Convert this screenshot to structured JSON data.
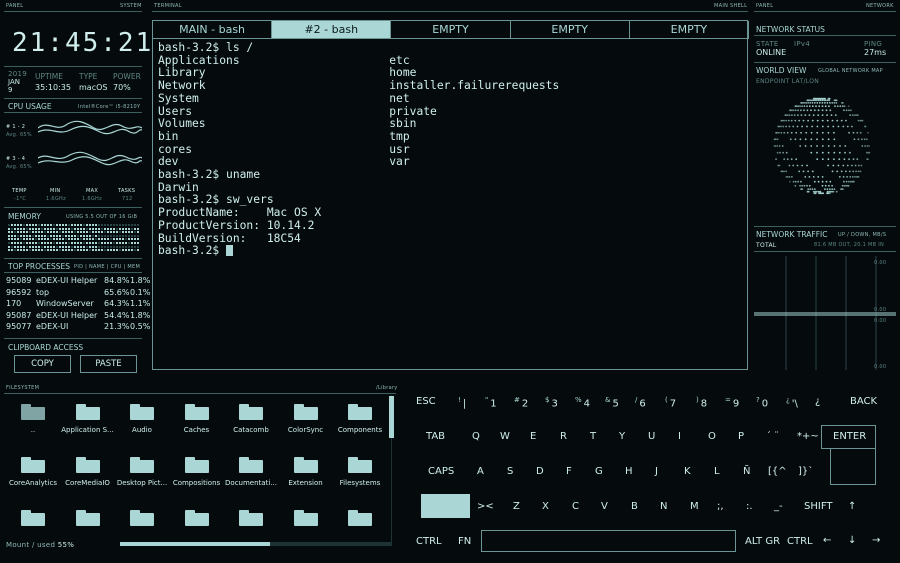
{
  "headers": {
    "left_panel": "PANEL",
    "left_system": "SYSTEM",
    "terminal": "TERMINAL",
    "main_shell": "MAIN SHELL",
    "right_panel": "PANEL",
    "right_network": "NETWORK",
    "filesystem": "FILESYSTEM",
    "fs_path": "/Library"
  },
  "clock": {
    "time": "21:45:21"
  },
  "sysinfo": {
    "year": "2019",
    "month": "JAN",
    "day": "9",
    "uptime_label": "UPTIME",
    "uptime": "35:10:35",
    "type_label": "TYPE",
    "type": "macOS",
    "power_label": "POWER",
    "power": "70%"
  },
  "cpu": {
    "title": "CPU USAGE",
    "model": "Intel®Core™ i5-8210Y",
    "core1_label": "# 1 - 2",
    "core1_avg": "Avg. 65%",
    "core2_label": "# 3 - 4",
    "core2_avg": "Avg. 65%",
    "temp_label": "TEMP",
    "temp": "-1°C",
    "min_label": "MIN",
    "min": "1.6GHz",
    "max_label": "MAX",
    "max": "1.6GHz",
    "tasks_label": "TASKS",
    "tasks": "712"
  },
  "memory": {
    "title": "MEMORY",
    "usage": "USING 5.5 OUT OF 16 GiB"
  },
  "processes": {
    "title": "TOP PROCESSES",
    "columns": "PID | NAME | CPU | MEM",
    "rows": [
      {
        "pid": "95089",
        "name": "eDEX-UI Helper",
        "cpu": "84.8%",
        "mem": "1.8%"
      },
      {
        "pid": "96592",
        "name": "top",
        "cpu": "65.6%",
        "mem": "0.1%"
      },
      {
        "pid": "170",
        "name": "WindowServer",
        "cpu": "64.3%",
        "mem": "1.1%"
      },
      {
        "pid": "95087",
        "name": "eDEX-UI Helper",
        "cpu": "54.4%",
        "mem": "1.8%"
      },
      {
        "pid": "95077",
        "name": "eDEX-UI",
        "cpu": "21.3%",
        "mem": "0.5%"
      }
    ]
  },
  "clipboard": {
    "title": "CLIPBOARD ACCESS",
    "copy": "COPY",
    "paste": "PASTE"
  },
  "terminal": {
    "tabs": [
      "MAIN - bash",
      "#2 - bash",
      "EMPTY",
      "EMPTY",
      "EMPTY"
    ],
    "active_tab": 1,
    "lines": [
      "bash-3.2$ ls /",
      "Applications                      etc",
      "Library                           home",
      "Network                           installer.failurerequests",
      "System                            net",
      "Users                             private",
      "Volumes                           sbin",
      "bin                               tmp",
      "cores                             usr",
      "dev                               var",
      "bash-3.2$ uname",
      "Darwin",
      "bash-3.2$ sw_vers",
      "ProductName:    Mac OS X",
      "ProductVersion: 10.14.2",
      "BuildVersion:   18C54",
      "bash-3.2$ "
    ]
  },
  "network": {
    "status_title": "NETWORK STATUS",
    "state_label": "STATE",
    "state": "ONLINE",
    "ipv_label": "IPv4",
    "ping_label": "PING",
    "ping": "27ms",
    "world_title": "WORLD VIEW",
    "world_sub": "GLOBAL NETWORK MAP",
    "endpoint": "ENDPOINT LAT/LON",
    "traffic_title": "NETWORK TRAFFIC",
    "traffic_sub": "UP / DOWN, MB/S",
    "total_label": "TOTAL",
    "total_value": "81.6 MB OUT, 20.1 MB IN",
    "scale": [
      "0.00",
      "0.00",
      "0.00",
      "0.00"
    ]
  },
  "filesystem": {
    "items": [
      "..",
      "Application S...",
      "Audio",
      "Caches",
      "Catacomb",
      "ColorSync",
      "Components",
      "CoreAnalytics",
      "CoreMediaIO",
      "Desktop Pict...",
      "Compositions",
      "Documentati...",
      "Extension",
      "Filesystems",
      "",
      "",
      "",
      "",
      "",
      "",
      ""
    ],
    "footer": "Mount / used",
    "used": "55%",
    "used_fraction": 0.55
  },
  "keyboard": {
    "row1": [
      {
        "k": "ESC"
      },
      {
        "s": "!",
        "k": "|"
      },
      {
        "s": "\"",
        "k": "1"
      },
      {
        "s": "#",
        "k": "2"
      },
      {
        "s": "$",
        "k": "3"
      },
      {
        "s": "%",
        "k": "4"
      },
      {
        "s": "&",
        "k": "5"
      },
      {
        "s": "/",
        "k": "6"
      },
      {
        "s": "(",
        "k": "7"
      },
      {
        "s": ")",
        "k": "8"
      },
      {
        "s": "=",
        "k": "9"
      },
      {
        "s": "?",
        "k": "0"
      },
      {
        "s": "¿",
        "k": "'\\"
      },
      {
        "k": "¿"
      },
      {
        "k": "BACK"
      }
    ],
    "row2": [
      "TAB",
      "Q",
      "W",
      "E",
      "R",
      "T",
      "Y",
      "U",
      "I",
      "O",
      "P",
      "´ ¨",
      "*+~",
      "ENTER"
    ],
    "row3": [
      "CAPS",
      "A",
      "S",
      "D",
      "F",
      "G",
      "H",
      "J",
      "K",
      "L",
      "Ñ",
      "[{^",
      "]}`"
    ],
    "row4": [
      "",
      "><",
      "Z",
      "X",
      "C",
      "V",
      "B",
      "N",
      "M",
      ";,",
      ":.",
      "_-",
      "SHIFT",
      "↑"
    ],
    "row5": [
      "CTRL",
      "FN",
      "ALT GR",
      "CTRL",
      "←",
      "↓",
      "→"
    ]
  }
}
